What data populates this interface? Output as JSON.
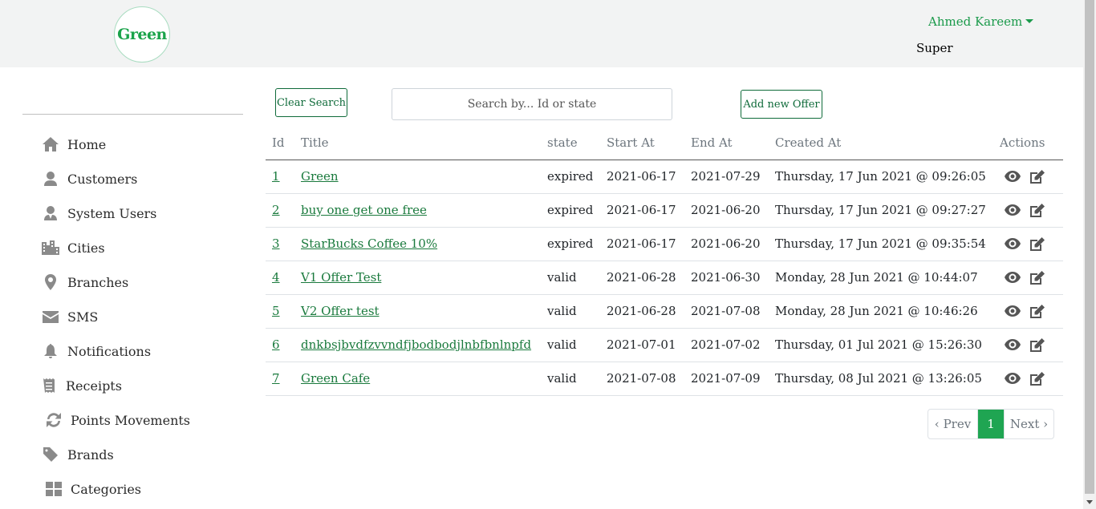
{
  "header": {
    "logo_text": "Green",
    "user_name": "Ahmed Kareem",
    "user_role": "Super"
  },
  "sidebar": {
    "items": [
      {
        "label": "Home",
        "icon": "home-icon"
      },
      {
        "label": "Customers",
        "icon": "user-icon"
      },
      {
        "label": "System Users",
        "icon": "user-tie-icon"
      },
      {
        "label": "Cities",
        "icon": "city-icon"
      },
      {
        "label": "Branches",
        "icon": "map-marker-icon"
      },
      {
        "label": "SMS",
        "icon": "envelope-icon"
      },
      {
        "label": "Notifications",
        "icon": "bell-icon"
      },
      {
        "label": "Receipts",
        "icon": "receipt-icon"
      },
      {
        "label": "Points Movements",
        "icon": "sync-icon"
      },
      {
        "label": "Brands",
        "icon": "tag-icon"
      },
      {
        "label": "Categories",
        "icon": "grid-icon"
      }
    ]
  },
  "toolbar": {
    "clear_label": "Clear Search",
    "search_placeholder": "Search by... Id or state",
    "add_label": "Add new Offer"
  },
  "table": {
    "headers": [
      "Id",
      "Title",
      "state",
      "Start At",
      "End At",
      "Created At",
      "Actions"
    ],
    "rows": [
      {
        "id": "1",
        "title": "Green",
        "state": "expired",
        "start": "2021-06-17",
        "end": "2021-07-29",
        "created": "Thursday, 17 Jun 2021 @ 09:26:05"
      },
      {
        "id": "2",
        "title": "buy one get one free",
        "state": "expired",
        "start": "2021-06-17",
        "end": "2021-06-20",
        "created": "Thursday, 17 Jun 2021 @ 09:27:27"
      },
      {
        "id": "3",
        "title": "StarBucks Coffee 10%",
        "state": "expired",
        "start": "2021-06-17",
        "end": "2021-06-20",
        "created": "Thursday, 17 Jun 2021 @ 09:35:54"
      },
      {
        "id": "4",
        "title": "V1 Offer Test",
        "state": "valid",
        "start": "2021-06-28",
        "end": "2021-06-30",
        "created": "Monday, 28 Jun 2021 @ 10:44:07"
      },
      {
        "id": "5",
        "title": "V2 Offer test",
        "state": "valid",
        "start": "2021-06-28",
        "end": "2021-07-08",
        "created": "Monday, 28 Jun 2021 @ 10:46:26"
      },
      {
        "id": "6",
        "title": "dnkbsjbvdfzvvndfjbodbodjlnbfbnlnpfd",
        "state": "valid",
        "start": "2021-07-01",
        "end": "2021-07-02",
        "created": "Thursday, 01 Jul 2021 @ 15:26:30"
      },
      {
        "id": "7",
        "title": "Green Cafe",
        "state": "valid",
        "start": "2021-07-08",
        "end": "2021-07-09",
        "created": "Thursday, 08 Jul 2021 @ 13:26:05"
      }
    ]
  },
  "pagination": {
    "prev_label": "‹ Prev",
    "current_page": "1",
    "next_label": "Next ›"
  },
  "colors": {
    "brand": "#1fa552",
    "link": "#1a7a3d",
    "header_bg": "#f2f3f3"
  }
}
